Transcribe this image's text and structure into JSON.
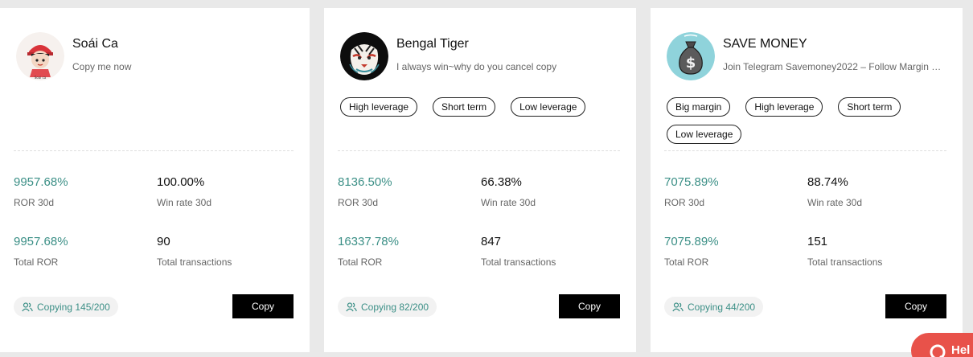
{
  "traders": [
    {
      "name": "Soái Ca",
      "bio": "Copy me now",
      "tags": [],
      "ror_30d": "9957.68%",
      "ror_30d_label": "ROR 30d",
      "win_rate_30d": "100.00%",
      "win_rate_label": "Win rate 30d",
      "total_ror": "9957.68%",
      "total_ror_label": "Total ROR",
      "total_transactions": "90",
      "total_transactions_label": "Total transactions",
      "copying": "Copying 145/200",
      "copy_label": "Copy",
      "avatar_icon": "cartoon-character-avatar-icon"
    },
    {
      "name": "Bengal Tiger",
      "bio": "I always win~why do you cancel copy",
      "tags": [
        "High leverage",
        "Short term",
        "Low leverage"
      ],
      "ror_30d": "8136.50%",
      "ror_30d_label": "ROR 30d",
      "win_rate_30d": "66.38%",
      "win_rate_label": "Win rate 30d",
      "total_ror": "16337.78%",
      "total_ror_label": "Total ROR",
      "total_transactions": "847",
      "total_transactions_label": "Total transactions",
      "copying": "Copying 82/200",
      "copy_label": "Copy",
      "avatar_icon": "tiger-avatar-icon"
    },
    {
      "name": "SAVE MONEY",
      "bio": "Join Telegram Savemoney2022 – Follow Margin …",
      "tags": [
        "Big margin",
        "High leverage",
        "Short term",
        "Low leverage"
      ],
      "ror_30d": "7075.89%",
      "ror_30d_label": "ROR 30d",
      "win_rate_30d": "88.74%",
      "win_rate_label": "Win rate 30d",
      "total_ror": "7075.89%",
      "total_ror_label": "Total ROR",
      "total_transactions": "151",
      "total_transactions_label": "Total transactions",
      "copying": "Copying 44/200",
      "copy_label": "Copy",
      "avatar_icon": "money-bag-avatar-icon"
    }
  ],
  "help": {
    "label": "Hel",
    "icon": "chat-help-icon"
  },
  "colors": {
    "accent": "#3b8f86",
    "copy_button": "#000000",
    "help_button": "#e8524a"
  }
}
